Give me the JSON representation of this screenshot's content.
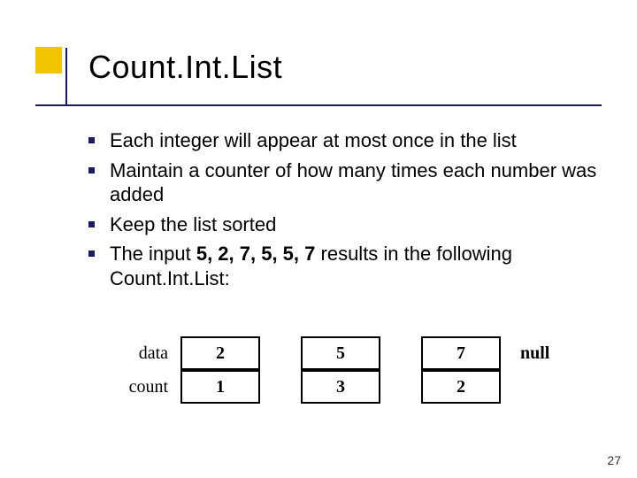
{
  "title": "Count.Int.List",
  "bullets": {
    "b1": "Each integer will appear at most once in the list",
    "b2": "Maintain a counter of how many times each number was added",
    "b3": "Keep the list sorted",
    "b4_pre": "The input ",
    "b4_bold": "5, 2, 7, 5, 5, 7",
    "b4_post": " results in the following Count.Int.List:"
  },
  "diagram": {
    "row1_label": "data",
    "row2_label": "count",
    "nodes": [
      {
        "data": "2",
        "count": "1"
      },
      {
        "data": "5",
        "count": "3"
      },
      {
        "data": "7",
        "count": "2"
      }
    ],
    "terminator": "null"
  },
  "page_number": "27",
  "chart_data": {
    "type": "table",
    "title": "Count.Int.List nodes",
    "columns": [
      "data",
      "count"
    ],
    "rows": [
      [
        "2",
        "1"
      ],
      [
        "5",
        "3"
      ],
      [
        "7",
        "2"
      ]
    ],
    "terminator": "null"
  }
}
